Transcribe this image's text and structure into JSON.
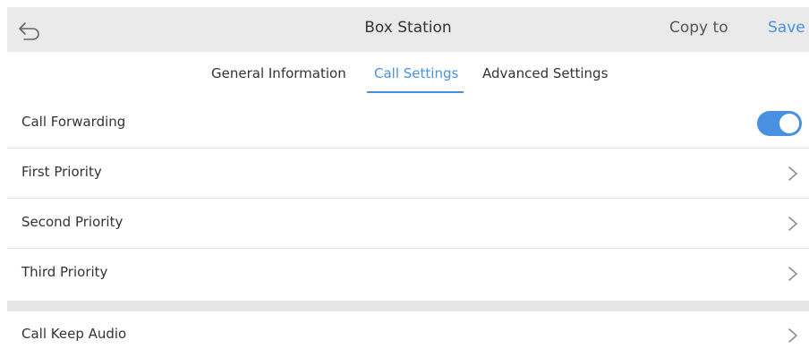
{
  "header": {
    "title": "Box Station",
    "copy_label": "Copy to",
    "save_label": "Save"
  },
  "tabs": [
    {
      "label": "General Information",
      "active": false
    },
    {
      "label": "Call Settings",
      "active": true
    },
    {
      "label": "Advanced Settings",
      "active": false
    }
  ],
  "settings": {
    "call_forwarding": {
      "label": "Call Forwarding",
      "enabled": true
    },
    "first_priority": {
      "label": "First Priority"
    },
    "second_priority": {
      "label": "Second Priority"
    },
    "third_priority": {
      "label": "Third Priority"
    },
    "call_keep_audio": {
      "label": "Call Keep Audio"
    }
  },
  "icons": {
    "back": "back-arrow-icon",
    "chevron": "chevron-right-icon"
  },
  "colors": {
    "accent": "#4a90e2",
    "header_bg": "#eaeaea",
    "separator": "#e6e6e6"
  }
}
